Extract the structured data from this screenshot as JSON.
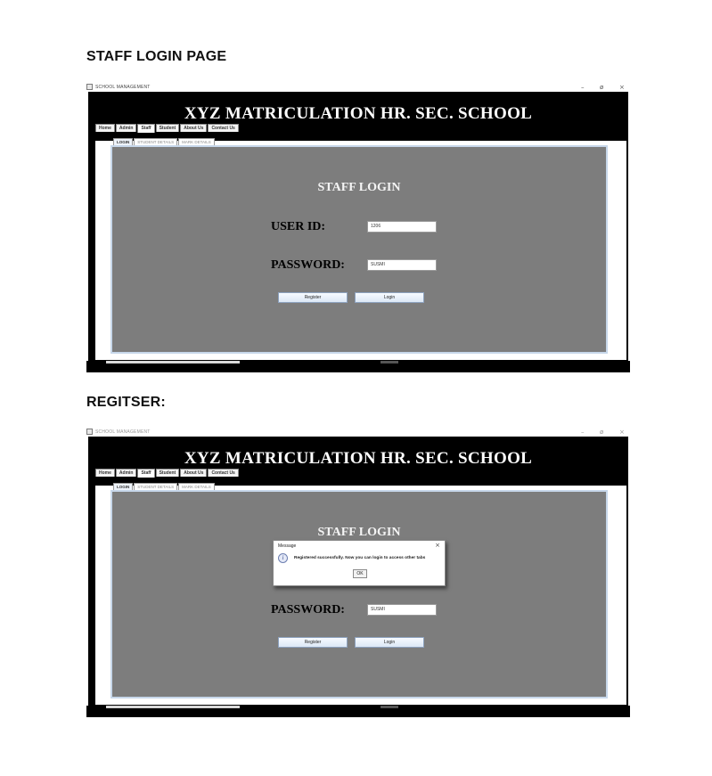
{
  "headings": {
    "first": "STAFF LOGIN PAGE",
    "second": "REGITSER:"
  },
  "window": {
    "title": "SCHOOL MANAGEMENT",
    "minimize": "–",
    "maximize": "ø",
    "close": "×"
  },
  "school_name": "XYZ MATRICULATION HR. SEC. SCHOOL",
  "tabs": [
    "Home",
    "Admin",
    "Staff",
    "Student",
    "About Us",
    "Contact Us"
  ],
  "active_tab": "Staff",
  "subtabs": [
    "LOGIN",
    "STUDENT DETAILS",
    "MARK DETAILS"
  ],
  "active_subtab": "LOGIN",
  "login": {
    "title": "STAFF LOGIN",
    "userid_label": "USER ID:",
    "userid_value": "1206",
    "password_label": "PASSWORD:",
    "password_value": "SUSMI",
    "register_label": "Register",
    "login_label": "Login"
  },
  "dialog": {
    "title": "Message",
    "close": "×",
    "icon": "info-icon",
    "icon_glyph": "i",
    "message": "Registered successfully. Now you can login to access other tabs",
    "ok_label": "OK"
  },
  "colors": {
    "panel": "#7d7d7d",
    "banner": "#000000",
    "panel_border": "#c7d7ea"
  }
}
